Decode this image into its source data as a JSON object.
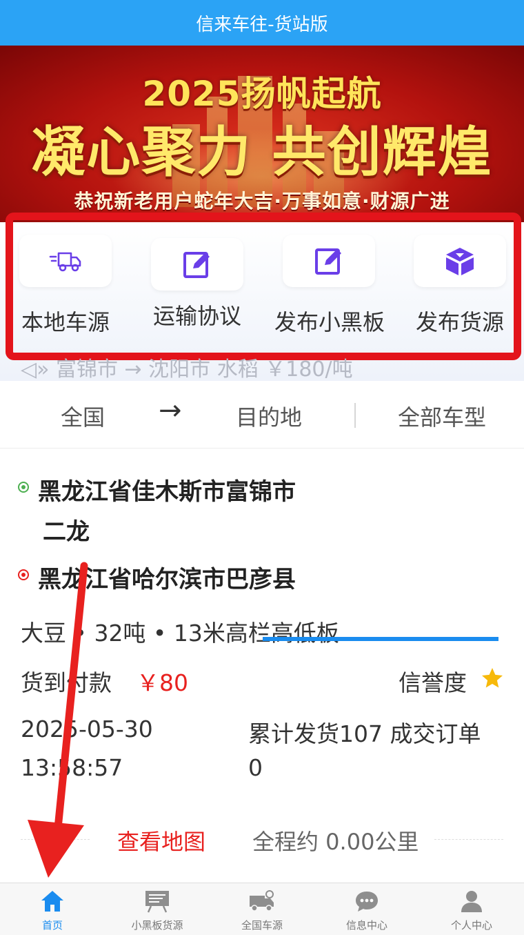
{
  "app": {
    "title": "信来车往-货站版"
  },
  "banner": {
    "line1": "2025扬帆起航",
    "line2": "凝心聚力 共创辉煌",
    "line3": "恭祝新老用户蛇年大吉·万事如意·财源广进"
  },
  "quick_actions": [
    {
      "label": "本地车源",
      "icon": "truck-icon"
    },
    {
      "label": "运输协议",
      "icon": "edit-icon"
    },
    {
      "label": "发布小黑板",
      "icon": "edit-icon"
    },
    {
      "label": "发布货源",
      "icon": "cargo-box-icon"
    }
  ],
  "ticker": {
    "text": "◁» 富锦市 → 沈阳市 水稻 ￥180/吨"
  },
  "filter": {
    "origin": "全国",
    "arrow": "→",
    "destination": "目的地",
    "vehicle_type": "全部车型"
  },
  "listing": {
    "from_line1": "黑龙江省佳木斯市富锦市",
    "from_line2": "二龙",
    "to": "黑龙江省哈尔滨市巴彦县",
    "cargo": "大豆 • 32吨 • 13米高栏高低板",
    "payment": "货到付款",
    "price": "￥80",
    "credit_label": "信誉度",
    "date": "2025-05-30",
    "time": "13:58:57",
    "stats_line1": "累计发货107 成交订单",
    "stats_line2": "0",
    "map_link": "查看地图",
    "distance": "全程约 0.00公里"
  },
  "tabbar": [
    {
      "label": "首页",
      "icon": "home-icon",
      "active": true
    },
    {
      "label": "小黑板货源",
      "icon": "blackboard-icon",
      "active": false
    },
    {
      "label": "全国车源",
      "icon": "truck-icon",
      "active": false
    },
    {
      "label": "信息中心",
      "icon": "chat-icon",
      "active": false
    },
    {
      "label": "个人中心",
      "icon": "user-icon",
      "active": false
    }
  ],
  "colors": {
    "header": "#2ba3f5",
    "accent": "#1a8cef",
    "price": "#e8211f",
    "icon_purple": "#6a3ee8",
    "highlight_border": "#e3141b"
  }
}
